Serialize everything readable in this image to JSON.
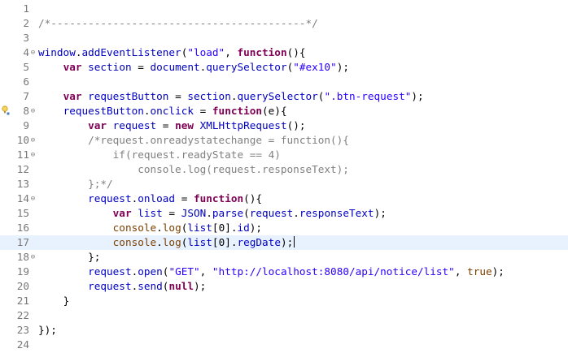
{
  "editor": {
    "language": "javascript",
    "current_line": 17,
    "colors": {
      "keyword": "#7f0055",
      "variable": "#0000c0",
      "string": "#2a00ff",
      "comment": "#808080",
      "line_number": "#787878",
      "current_line_background": "#e8f2fe"
    },
    "lines": [
      {
        "num": "1",
        "fold": "",
        "marker": "",
        "tokens": []
      },
      {
        "num": "2",
        "fold": "",
        "marker": "",
        "tokens": [
          {
            "t": "/*-----------------------------------------*/",
            "c": "cm2"
          }
        ]
      },
      {
        "num": "3",
        "fold": "",
        "marker": "",
        "tokens": []
      },
      {
        "num": "4",
        "fold": "⊖",
        "marker": "",
        "tokens": [
          {
            "t": "window",
            "c": "var"
          },
          {
            "t": ".",
            "c": "punc"
          },
          {
            "t": "addEventListener",
            "c": "var"
          },
          {
            "t": "(",
            "c": "punc"
          },
          {
            "t": "\"load\"",
            "c": "str"
          },
          {
            "t": ", ",
            "c": "punc"
          },
          {
            "t": "function",
            "c": "kw"
          },
          {
            "t": "(){",
            "c": "punc"
          }
        ]
      },
      {
        "num": "5",
        "fold": "",
        "marker": "",
        "tokens": [
          {
            "t": "    ",
            "c": "punc"
          },
          {
            "t": "var",
            "c": "kw"
          },
          {
            "t": " ",
            "c": "punc"
          },
          {
            "t": "section",
            "c": "var"
          },
          {
            "t": " = ",
            "c": "punc"
          },
          {
            "t": "document",
            "c": "var"
          },
          {
            "t": ".",
            "c": "punc"
          },
          {
            "t": "querySelector",
            "c": "var"
          },
          {
            "t": "(",
            "c": "punc"
          },
          {
            "t": "\"#ex10\"",
            "c": "str"
          },
          {
            "t": ");",
            "c": "punc"
          }
        ]
      },
      {
        "num": "6",
        "fold": "",
        "marker": "",
        "tokens": []
      },
      {
        "num": "7",
        "fold": "",
        "marker": "",
        "tokens": [
          {
            "t": "    ",
            "c": "punc"
          },
          {
            "t": "var",
            "c": "kw"
          },
          {
            "t": " ",
            "c": "punc"
          },
          {
            "t": "requestButton",
            "c": "var"
          },
          {
            "t": " = ",
            "c": "punc"
          },
          {
            "t": "section",
            "c": "var"
          },
          {
            "t": ".",
            "c": "punc"
          },
          {
            "t": "querySelector",
            "c": "var"
          },
          {
            "t": "(",
            "c": "punc"
          },
          {
            "t": "\".btn-request\"",
            "c": "str"
          },
          {
            "t": ");",
            "c": "punc"
          }
        ]
      },
      {
        "num": "8",
        "fold": "⊖",
        "marker": "warning",
        "tokens": [
          {
            "t": "    ",
            "c": "punc"
          },
          {
            "t": "requestButton",
            "c": "var"
          },
          {
            "t": ".",
            "c": "punc"
          },
          {
            "t": "onclick",
            "c": "var"
          },
          {
            "t": " = ",
            "c": "punc"
          },
          {
            "t": "function",
            "c": "kw"
          },
          {
            "t": "(e){",
            "c": "punc"
          }
        ]
      },
      {
        "num": "9",
        "fold": "",
        "marker": "",
        "tokens": [
          {
            "t": "        ",
            "c": "punc"
          },
          {
            "t": "var",
            "c": "kw"
          },
          {
            "t": " ",
            "c": "punc"
          },
          {
            "t": "request",
            "c": "var"
          },
          {
            "t": " = ",
            "c": "punc"
          },
          {
            "t": "new",
            "c": "kw2"
          },
          {
            "t": " ",
            "c": "punc"
          },
          {
            "t": "XMLHttpRequest",
            "c": "var"
          },
          {
            "t": "();",
            "c": "punc"
          }
        ]
      },
      {
        "num": "10",
        "fold": "⊖",
        "marker": "",
        "tokens": [
          {
            "t": "        ",
            "c": "punc"
          },
          {
            "t": "/*request.onreadystatechange = function(){",
            "c": "cm2"
          }
        ]
      },
      {
        "num": "11",
        "fold": "⊖",
        "marker": "",
        "tokens": [
          {
            "t": "            ",
            "c": "punc"
          },
          {
            "t": "if(request.readyState == 4)",
            "c": "cm2"
          }
        ]
      },
      {
        "num": "12",
        "fold": "",
        "marker": "",
        "tokens": [
          {
            "t": "                ",
            "c": "punc"
          },
          {
            "t": "console.log(request.responseText);",
            "c": "cm2"
          }
        ]
      },
      {
        "num": "13",
        "fold": "",
        "marker": "",
        "tokens": [
          {
            "t": "        ",
            "c": "punc"
          },
          {
            "t": "};*/",
            "c": "cm2"
          }
        ]
      },
      {
        "num": "14",
        "fold": "⊖",
        "marker": "",
        "tokens": [
          {
            "t": "        ",
            "c": "punc"
          },
          {
            "t": "request",
            "c": "var"
          },
          {
            "t": ".",
            "c": "punc"
          },
          {
            "t": "onload",
            "c": "var"
          },
          {
            "t": " = ",
            "c": "punc"
          },
          {
            "t": "function",
            "c": "kw"
          },
          {
            "t": "(){",
            "c": "punc"
          }
        ]
      },
      {
        "num": "15",
        "fold": "",
        "marker": "",
        "tokens": [
          {
            "t": "            ",
            "c": "punc"
          },
          {
            "t": "var",
            "c": "kw"
          },
          {
            "t": " ",
            "c": "punc"
          },
          {
            "t": "list",
            "c": "var"
          },
          {
            "t": " = ",
            "c": "punc"
          },
          {
            "t": "JSON",
            "c": "var"
          },
          {
            "t": ".",
            "c": "punc"
          },
          {
            "t": "parse",
            "c": "var"
          },
          {
            "t": "(",
            "c": "punc"
          },
          {
            "t": "request",
            "c": "var"
          },
          {
            "t": ".",
            "c": "punc"
          },
          {
            "t": "responseText",
            "c": "var"
          },
          {
            "t": ");",
            "c": "punc"
          }
        ]
      },
      {
        "num": "16",
        "fold": "",
        "marker": "",
        "tokens": [
          {
            "t": "            ",
            "c": "punc"
          },
          {
            "t": "console",
            "c": "con"
          },
          {
            "t": ".",
            "c": "punc"
          },
          {
            "t": "log",
            "c": "con"
          },
          {
            "t": "(",
            "c": "punc"
          },
          {
            "t": "list",
            "c": "var"
          },
          {
            "t": "[",
            "c": "punc"
          },
          {
            "t": "0",
            "c": "punc"
          },
          {
            "t": "].",
            "c": "punc"
          },
          {
            "t": "id",
            "c": "var"
          },
          {
            "t": ");",
            "c": "punc"
          }
        ]
      },
      {
        "num": "17",
        "fold": "",
        "marker": "",
        "tokens": [
          {
            "t": "            ",
            "c": "punc"
          },
          {
            "t": "console",
            "c": "con"
          },
          {
            "t": ".",
            "c": "punc"
          },
          {
            "t": "log",
            "c": "con"
          },
          {
            "t": "(",
            "c": "punc"
          },
          {
            "t": "list",
            "c": "var"
          },
          {
            "t": "[",
            "c": "punc"
          },
          {
            "t": "0",
            "c": "punc"
          },
          {
            "t": "].",
            "c": "punc"
          },
          {
            "t": "regDate",
            "c": "var"
          },
          {
            "t": ");",
            "c": "punc"
          }
        ]
      },
      {
        "num": "18",
        "fold": "⊖",
        "marker": "",
        "tokens": [
          {
            "t": "        ",
            "c": "punc"
          },
          {
            "t": "};",
            "c": "punc"
          }
        ]
      },
      {
        "num": "19",
        "fold": "",
        "marker": "",
        "tokens": [
          {
            "t": "        ",
            "c": "punc"
          },
          {
            "t": "request",
            "c": "var"
          },
          {
            "t": ".",
            "c": "punc"
          },
          {
            "t": "open",
            "c": "var"
          },
          {
            "t": "(",
            "c": "punc"
          },
          {
            "t": "\"GET\"",
            "c": "str"
          },
          {
            "t": ", ",
            "c": "punc"
          },
          {
            "t": "\"http://localhost:8080/api/notice/list\"",
            "c": "str"
          },
          {
            "t": ", ",
            "c": "punc"
          },
          {
            "t": "true",
            "c": "con"
          },
          {
            "t": ");",
            "c": "punc"
          }
        ]
      },
      {
        "num": "20",
        "fold": "",
        "marker": "",
        "tokens": [
          {
            "t": "        ",
            "c": "punc"
          },
          {
            "t": "request",
            "c": "var"
          },
          {
            "t": ".",
            "c": "punc"
          },
          {
            "t": "send",
            "c": "var"
          },
          {
            "t": "(",
            "c": "punc"
          },
          {
            "t": "null",
            "c": "kw2"
          },
          {
            "t": ");",
            "c": "punc"
          }
        ]
      },
      {
        "num": "21",
        "fold": "",
        "marker": "",
        "tokens": [
          {
            "t": "    ",
            "c": "punc"
          },
          {
            "t": "}",
            "c": "punc"
          }
        ]
      },
      {
        "num": "22",
        "fold": "",
        "marker": "",
        "tokens": []
      },
      {
        "num": "23",
        "fold": "",
        "marker": "",
        "tokens": [
          {
            "t": "});",
            "c": "punc"
          }
        ]
      },
      {
        "num": "24",
        "fold": "",
        "marker": "",
        "tokens": []
      }
    ]
  }
}
